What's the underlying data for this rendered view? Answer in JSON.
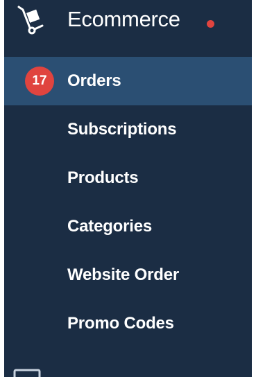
{
  "colors": {
    "panel_bg": "#1b2d44",
    "active_bg": "#2b4f73",
    "accent_red": "#e0443f",
    "text": "#ffffff"
  },
  "header": {
    "icon": "hand-truck-icon",
    "title": "Ecommerce",
    "status_dot": "notification-dot"
  },
  "menu": {
    "items": [
      {
        "label": "Orders",
        "badge": "17",
        "active": true
      },
      {
        "label": "Subscriptions"
      },
      {
        "label": "Products"
      },
      {
        "label": "Categories"
      },
      {
        "label": "Website Order"
      },
      {
        "label": "Promo Codes"
      }
    ]
  },
  "footer": {
    "icon": "monitor-icon"
  }
}
